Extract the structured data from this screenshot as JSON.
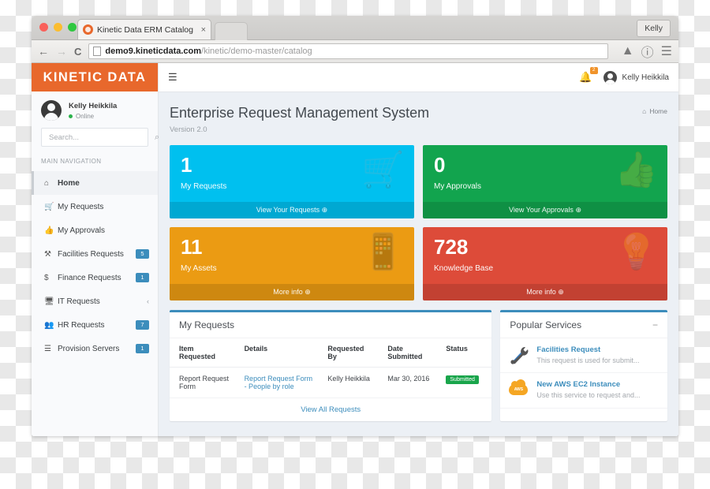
{
  "browser": {
    "tab_title": "Kinetic Data ERM Catalog",
    "tab_close": "×",
    "profile_label": "Kelly",
    "back_icon": "←",
    "forward_icon": "→",
    "reload_icon": "C",
    "url_domain": "demo9.kineticdata.com",
    "url_path": "/kinetic/demo-master/catalog",
    "cloud_icon": "▲",
    "info_icon": "ⓘ",
    "menu_icon": "☰"
  },
  "sidebar": {
    "brand": "KINETIC DATA",
    "user": {
      "name": "Kelly Heikkila",
      "status": "Online"
    },
    "search": {
      "placeholder": "Search...",
      "value": "",
      "icon": "⌕"
    },
    "nav_heading": "MAIN NAVIGATION",
    "items": [
      {
        "label": "Home",
        "icon": "⌂",
        "badge": "",
        "chevron": ""
      },
      {
        "label": "My Requests",
        "icon": "Ὥ2",
        "badge": "",
        "chevron": ""
      },
      {
        "label": "My Approvals",
        "icon": "☝",
        "badge": "",
        "chevron": ""
      },
      {
        "label": "Facilities Requests",
        "icon": "⚒",
        "badge": "5",
        "chevron": ""
      },
      {
        "label": "Finance Requests",
        "icon": "$",
        "badge": "1",
        "chevron": ""
      },
      {
        "label": "IT Requests",
        "icon": "▣",
        "badge": "",
        "chevron": "‹"
      },
      {
        "label": "HR Requests",
        "icon": "♟",
        "badge": "7",
        "chevron": ""
      },
      {
        "label": "Provision Servers",
        "icon": "☰",
        "badge": "1",
        "chevron": ""
      }
    ]
  },
  "topbar": {
    "hamburger": "☰",
    "bell_icon": "☐",
    "bell_count": "2",
    "user_name": "Kelly Heikkila"
  },
  "page": {
    "title": "Enterprise Request Management System",
    "version": "Version 2.0",
    "breadcrumb_icon": "⌂",
    "breadcrumb": "Home"
  },
  "tiles": [
    {
      "value": "1",
      "caption": "My Requests",
      "footer": "View Your Requests",
      "footer_icon": "⊕",
      "color": "#00c0ef",
      "icon": "cart-icon"
    },
    {
      "value": "0",
      "caption": "My Approvals",
      "footer": "View Your Approvals",
      "footer_icon": "⊕",
      "color": "#12a44e",
      "icon": "thumbs-up-icon"
    },
    {
      "value": "11",
      "caption": "My Assets",
      "footer": "More info",
      "footer_icon": "⊕",
      "color": "#eb9b13",
      "icon": "mobile-phone-icon"
    },
    {
      "value": "728",
      "caption": "Knowledge Base",
      "footer": "More info",
      "footer_icon": "⊕",
      "color": "#dd4b39",
      "icon": "lightbulb-icon"
    }
  ],
  "requests_panel": {
    "title": "My Requests",
    "columns": [
      "Item Requested",
      "Details",
      "Requested By",
      "Date Submitted",
      "Status"
    ],
    "rows": [
      {
        "item": "Report Request Form",
        "details": "Report Request Form - People by role",
        "requested_by": "Kelly Heikkila",
        "date": "Mar 30, 2016",
        "status": "Submitted"
      }
    ],
    "view_all": "View All Requests"
  },
  "services_panel": {
    "title": "Popular Services",
    "collapse_icon": "−",
    "items": [
      {
        "title": "Facilities Request",
        "desc": "This request is used for submit...",
        "icon": "tools-icon"
      },
      {
        "title": "New AWS EC2 Instance",
        "desc": "Use this service to request and...",
        "icon": "aws-cloud-icon",
        "badge_text": "AWS"
      }
    ]
  }
}
